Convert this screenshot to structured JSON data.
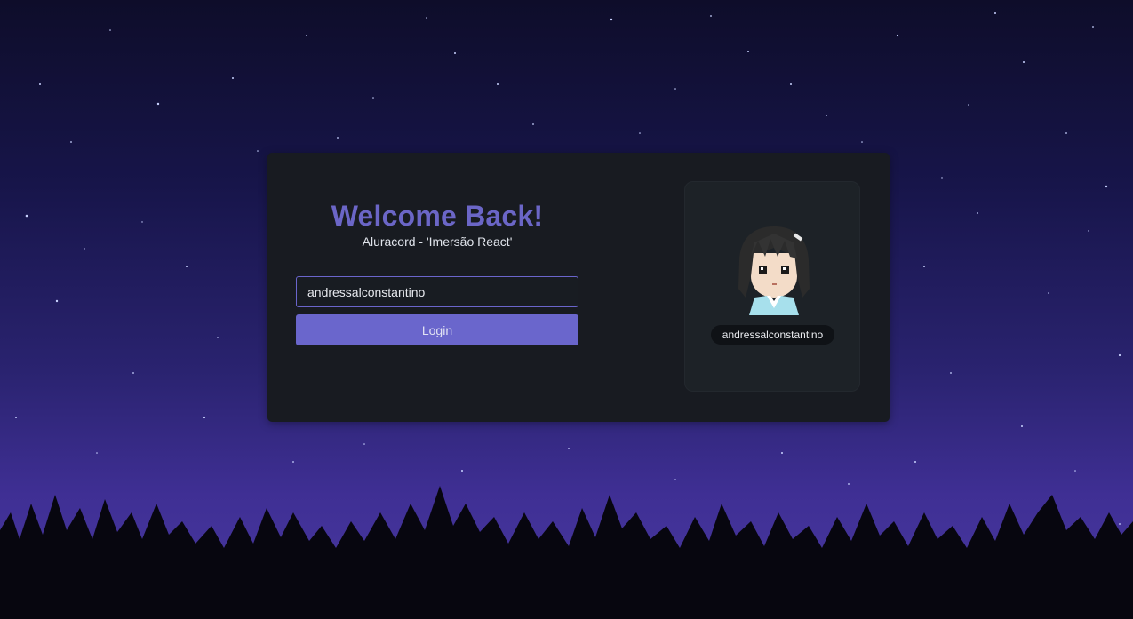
{
  "login": {
    "title": "Welcome Back!",
    "subtitle": "Aluracord - 'Imersão React'",
    "username_value": "andressalconstantino",
    "login_button": "Login"
  },
  "profile": {
    "username": "andressalconstantino",
    "avatar_icon": "pixel-anime-girl-avatar"
  },
  "colors": {
    "accent": "#6a66cc",
    "card_bg": "#181b21",
    "panel_bg": "#1d2227",
    "title": "#6b66c7"
  }
}
